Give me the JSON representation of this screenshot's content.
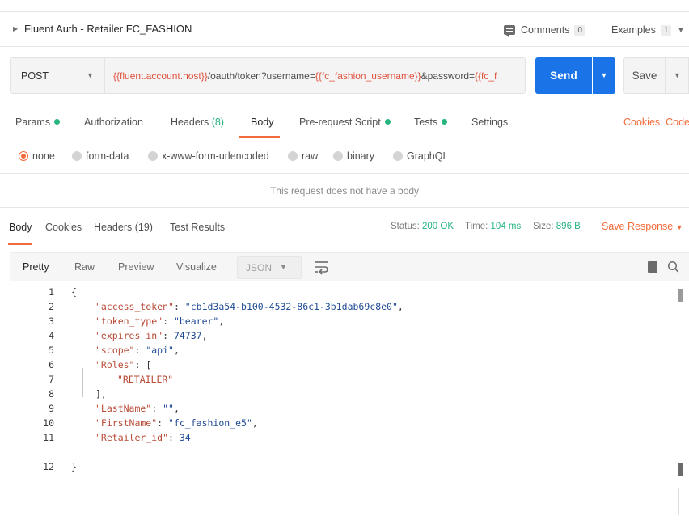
{
  "title_bar": {
    "title": "Fluent Auth - Retailer FC_FASHION",
    "comments_label": "Comments",
    "comments_count": "0",
    "examples_label": "Examples",
    "examples_count": "1"
  },
  "request": {
    "method": "POST",
    "url_parts": {
      "p1": "{{fluent.account.host}}",
      "p2": "/oauth/token?username=",
      "p3": "{{fc_fashion_username}}",
      "p4": "&password=",
      "p5": "{{fc_f"
    },
    "send_label": "Send",
    "save_label": "Save"
  },
  "request_tabs": {
    "params": "Params",
    "authorization": "Authorization",
    "headers": "Headers",
    "headers_count": "(8)",
    "body": "Body",
    "pre_request": "Pre-request Script",
    "tests": "Tests",
    "settings": "Settings",
    "cookies": "Cookies",
    "code": "Code"
  },
  "body_types": {
    "none": "none",
    "form_data": "form-data",
    "urlencoded": "x-www-form-urlencoded",
    "raw": "raw",
    "binary": "binary",
    "graphql": "GraphQL",
    "selected": "none"
  },
  "no_body_message": "This request does not have a body",
  "response": {
    "tabs": {
      "body": "Body",
      "cookies": "Cookies",
      "headers": "Headers (19)",
      "test_results": "Test Results"
    },
    "status_label": "Status:",
    "status_value": "200 OK",
    "time_label": "Time:",
    "time_value": "104 ms",
    "size_label": "Size:",
    "size_value": "896 B",
    "save_response": "Save Response"
  },
  "viewer": {
    "pretty": "Pretty",
    "raw": "Raw",
    "preview": "Preview",
    "visualize": "Visualize",
    "format": "JSON"
  },
  "code_lines": [
    {
      "n": "1",
      "text": "{"
    },
    {
      "n": "2",
      "key": "\"access_token\"",
      "sep": ": ",
      "val": "\"cb1d3a54-b100-4532-86c1-3b1dab69c8e0\"",
      "end": ","
    },
    {
      "n": "3",
      "key": "\"token_type\"",
      "sep": ": ",
      "val": "\"bearer\"",
      "end": ","
    },
    {
      "n": "4",
      "key": "\"expires_in\"",
      "sep": ": ",
      "val": "74737",
      "end": ","
    },
    {
      "n": "5",
      "key": "\"scope\"",
      "sep": ": ",
      "val": "\"api\"",
      "end": ","
    },
    {
      "n": "6",
      "key": "\"Roles\"",
      "sep": ": ",
      "val": "",
      "end": "["
    },
    {
      "n": "7",
      "key": "",
      "sep": "",
      "val": "\"RETAILER\"",
      "end": ""
    },
    {
      "n": "8",
      "text": "],"
    },
    {
      "n": "9",
      "key": "\"LastName\"",
      "sep": ": ",
      "val": "\"\"",
      "end": ","
    },
    {
      "n": "10",
      "key": "\"FirstName\"",
      "sep": ": ",
      "val": "\"fc_fashion_e5\"",
      "end": ","
    },
    {
      "n": "11",
      "key": "\"Retailer_id\"",
      "sep": ": ",
      "val": "34",
      "end": ""
    },
    {
      "n": "12",
      "text": "}"
    }
  ],
  "colors": {
    "accent": "#f26b3a",
    "send_blue": "#1b73e8",
    "success_green": "#26b47f",
    "variable_red": "#e0533f"
  }
}
